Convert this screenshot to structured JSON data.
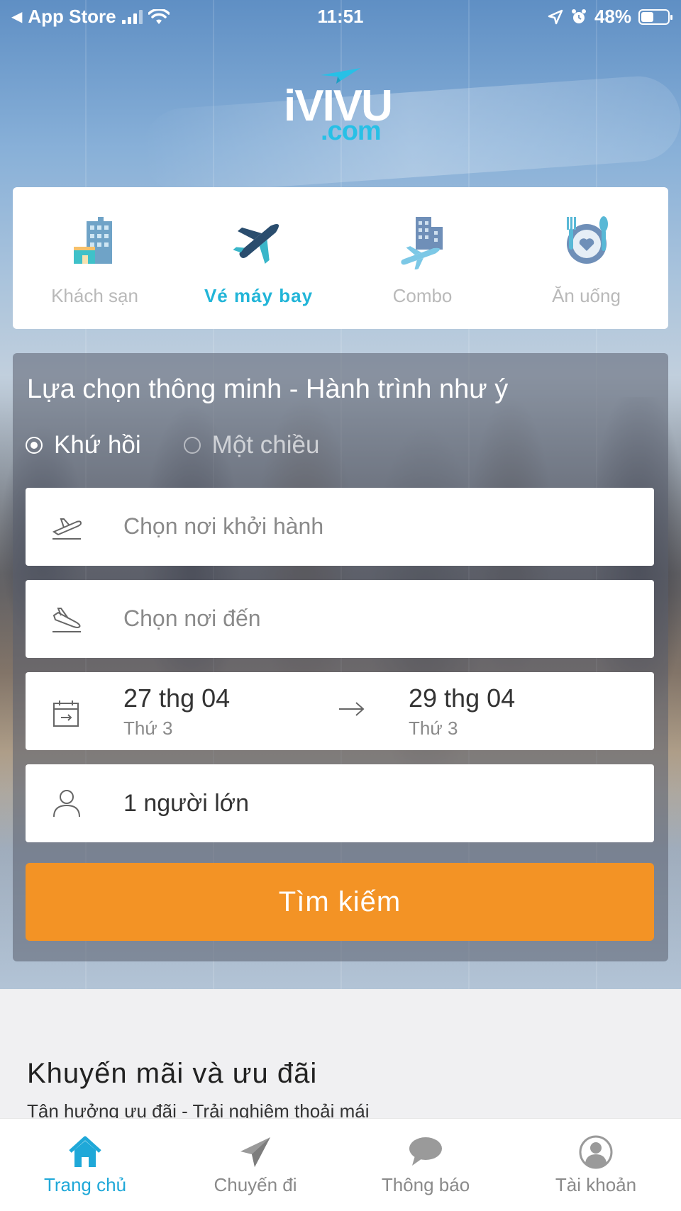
{
  "status_bar": {
    "back_app": "App Store",
    "time": "11:51",
    "battery": "48%",
    "battery_level": 0.48
  },
  "logo": {
    "wordmark": "iVIVU",
    "suffix": ".com"
  },
  "categories": [
    {
      "label": "Khách sạn",
      "icon": "hotel-icon",
      "active": false
    },
    {
      "label": "Vé máy bay",
      "icon": "airplane-icon",
      "active": true
    },
    {
      "label": "Combo",
      "icon": "combo-icon",
      "active": false
    },
    {
      "label": "Ăn uống",
      "icon": "dining-icon",
      "active": false
    }
  ],
  "search": {
    "title": "Lựa chọn thông minh - Hành trình như ý",
    "trip_types": [
      {
        "label": "Khứ hồi",
        "selected": true
      },
      {
        "label": "Một chiều",
        "selected": false
      }
    ],
    "origin_placeholder": "Chọn nơi khởi hành",
    "destination_placeholder": "Chọn nơi đến",
    "depart_date": "27 thg 04",
    "depart_day": "Thứ 3",
    "return_date": "29 thg 04",
    "return_day": "Thứ 3",
    "passengers": "1 người lớn",
    "button_label": "Tìm kiếm"
  },
  "promotions": {
    "title": "Khuyến mãi và ưu đãi",
    "subtitle": "Tận hưởng ưu đãi - Trải nghiệm thoải mái"
  },
  "tabs": [
    {
      "label": "Trang chủ",
      "icon": "home-icon",
      "active": true
    },
    {
      "label": "Chuyến đi",
      "icon": "paper-plane-icon",
      "active": false
    },
    {
      "label": "Thông báo",
      "icon": "chat-bubble-icon",
      "active": false
    },
    {
      "label": "Tài khoản",
      "icon": "account-icon",
      "active": false
    }
  ],
  "colors": {
    "accent": "#22b5d8",
    "button": "#f39325",
    "tab_active": "#1fa8d8"
  }
}
